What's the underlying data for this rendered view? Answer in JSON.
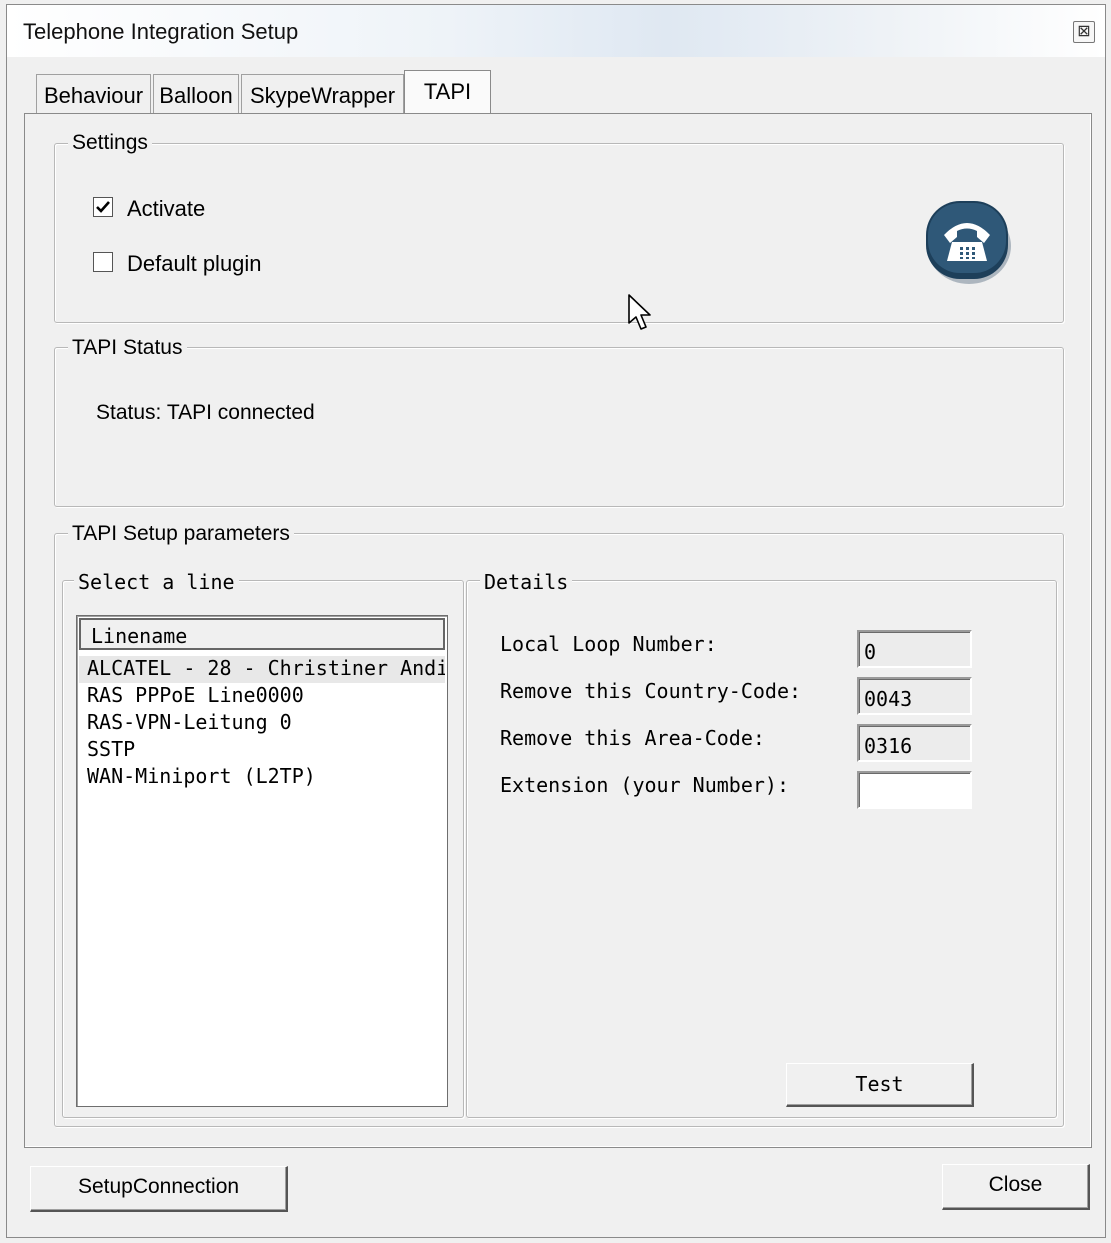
{
  "window": {
    "title": "Telephone Integration Setup",
    "close_glyph": "⊠"
  },
  "tabs": [
    {
      "label": "Behaviour",
      "active": false
    },
    {
      "label": "Balloon",
      "active": false
    },
    {
      "label": "SkypeWrapper",
      "active": false
    },
    {
      "label": "TAPI",
      "active": true
    }
  ],
  "settings": {
    "legend": "Settings",
    "activate": {
      "label": "Activate",
      "checked": true
    },
    "default_plugin": {
      "label": "Default plugin",
      "checked": false
    },
    "icon": "skype-phone-icon"
  },
  "status": {
    "legend": "TAPI Status",
    "text": "Status: TAPI connected"
  },
  "setup": {
    "legend": "TAPI Setup parameters",
    "line_select": {
      "legend": "Select a line",
      "column_header": "Linename",
      "items": [
        "ALCATEL - 28 - Christiner Andi",
        "RAS PPPoE Line0000",
        "RAS-VPN-Leitung 0",
        "SSTP",
        "WAN-Miniport (L2TP)"
      ],
      "selected_index": 0
    },
    "details": {
      "legend": "Details",
      "local_loop": {
        "label": "Local Loop Number:",
        "value": "0"
      },
      "country_code": {
        "label": "Remove this Country-Code:",
        "value": "0043"
      },
      "area_code": {
        "label": "Remove this Area-Code:",
        "value": "0316"
      },
      "extension": {
        "label": "Extension (your Number):",
        "value": ""
      },
      "test_label": "Test"
    }
  },
  "footer": {
    "setup_connection_label": "SetupConnection",
    "close_label": "Close"
  }
}
